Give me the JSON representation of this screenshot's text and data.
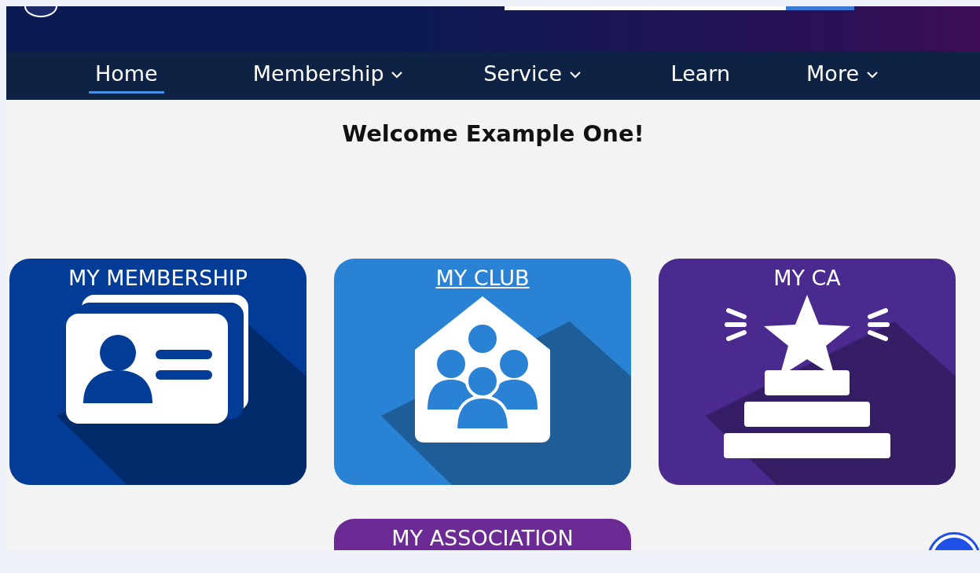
{
  "nav": [
    {
      "label": "Home",
      "selected": true,
      "dropdown": false
    },
    {
      "label": "Membership",
      "selected": false,
      "dropdown": true
    },
    {
      "label": "Service",
      "selected": false,
      "dropdown": true
    },
    {
      "label": "Learn",
      "selected": false,
      "dropdown": false
    },
    {
      "label": "More",
      "selected": false,
      "dropdown": true
    }
  ],
  "welcome": "Welcome Example One!",
  "tiles": [
    {
      "title": "MY MEMBERSHIP",
      "kind": "membership",
      "color": "#033c96",
      "hovered": false
    },
    {
      "title": "MY CLUB",
      "kind": "club",
      "color": "#2a82d4",
      "hovered": true
    },
    {
      "title": "MY CA",
      "kind": "ca",
      "color": "#4a2a8e",
      "hovered": false
    },
    {
      "title": "MY ASSOCIATION",
      "kind": "association",
      "color": "#6b2a94",
      "hovered": false
    }
  ]
}
